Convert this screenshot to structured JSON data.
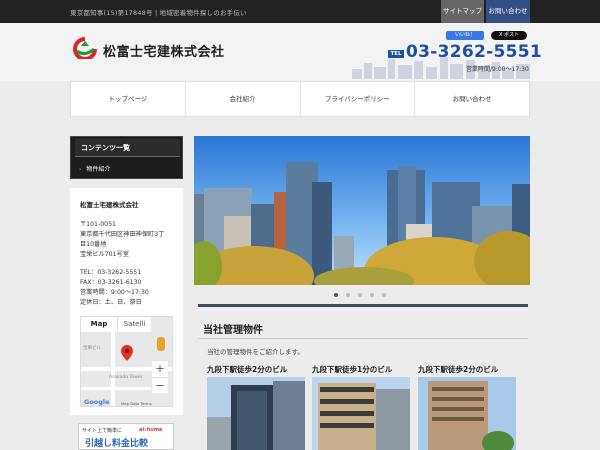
{
  "topbar": {
    "notice": "東京都知事(15)第17848号 | 地域密着物件探しのお手伝い",
    "sitemap_label": "サイトマップ",
    "contact_label": "お問い合わせ"
  },
  "header": {
    "company_name": "松富士宅建株式会社",
    "facebook_label": "いいね！",
    "x_label": "X ポスト",
    "tel_badge": "TEL",
    "tel": "03-3262-5551",
    "hours": "営業時間/9:00〜17:30"
  },
  "nav": {
    "items": [
      {
        "label": "トップページ"
      },
      {
        "label": "会社紹介"
      },
      {
        "label": "プライバシーポリシー"
      },
      {
        "label": "お問い合わせ"
      }
    ]
  },
  "sidebar": {
    "menu_title": "コンテンツ一覧",
    "menu_item": "物件紹介",
    "info": {
      "title": "松富士宅建株式会社",
      "postal": "〒101-0051",
      "address1": "東京都千代田区神田神保町3丁",
      "address2": "目10番地",
      "building": "宝栄ビル701号室",
      "tel": "TEL：03-3262-5551",
      "fax": "FAX：03-3261-6130",
      "hours": "営業時間：9:00～17:30",
      "holiday": "定休日：土、日、祭日"
    },
    "map": {
      "map_label": "Map",
      "satellite_label": "Satelli",
      "place_label_1": "宝栄ビル",
      "place_label_2": "Asakado Tower",
      "google_label": "Google",
      "data_label": "Map Data   Terms"
    },
    "banner": {
      "line1": "サイト上で簡単に",
      "brand": "at-home",
      "headline": "引越し料金比較"
    }
  },
  "main": {
    "slider_dots": 5,
    "active_dot": 1,
    "section_title": "当社管理物件",
    "section_desc": "当社の管理物件をご紹介します。",
    "properties": [
      {
        "title": "九段下駅徒歩2分のビル"
      },
      {
        "title": "九段下駅徒歩1分のビル"
      },
      {
        "title": "九段下駅徒歩2分のビル"
      }
    ]
  },
  "colors": {
    "topbar": "#222222",
    "accent_blue": "#1f4fa0",
    "contact_btn": "#344f86"
  }
}
